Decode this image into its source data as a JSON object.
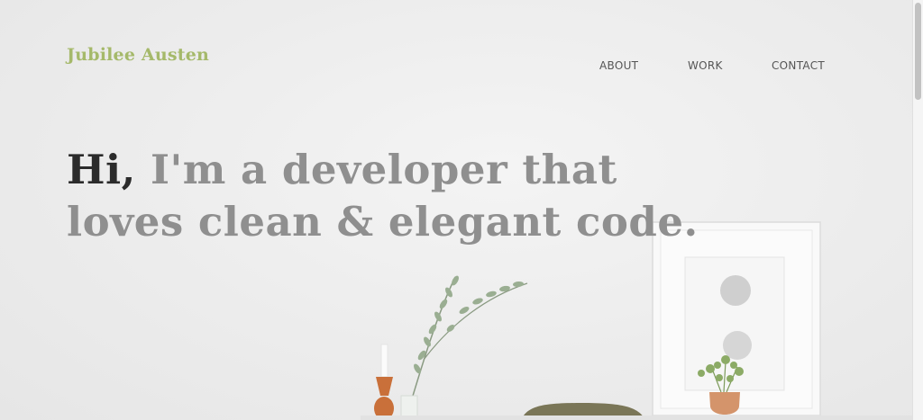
{
  "brand": {
    "name": "Jubilee Austen",
    "color": "#a5b96a"
  },
  "nav": {
    "items": [
      {
        "label": "ABOUT"
      },
      {
        "label": "WORK"
      },
      {
        "label": "CONTACT"
      }
    ]
  },
  "hero": {
    "greeting": "Hi,",
    "line1": " I'm a developer that",
    "line2": "loves clean & elegant code."
  },
  "colors": {
    "greeting": "#2b2b2b",
    "headline": "#8f8f8f",
    "nav": "#555555"
  }
}
